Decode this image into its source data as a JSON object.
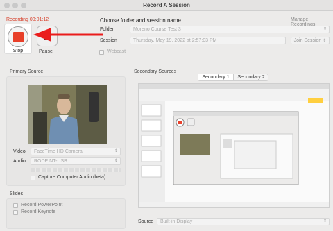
{
  "window": {
    "title": "Record A Session"
  },
  "recording": {
    "status": "Recording 00:01:12"
  },
  "controls": {
    "stop_label": "Stop",
    "pause_label": "Pause"
  },
  "header": {
    "choose_label": "Choose folder and session name",
    "manage_label": "Manage Recordings"
  },
  "folder": {
    "label": "Folder",
    "value": "Moreno Course Test 3"
  },
  "session": {
    "label": "Session",
    "value": "Thursday, May 19, 2022 at 2:57:03 PM",
    "join_label": "Join Session"
  },
  "webcast": {
    "label": "Webcast"
  },
  "primary": {
    "title": "Primary Source",
    "video_label": "Video",
    "video_value": "FaceTime HD Camera",
    "audio_label": "Audio",
    "audio_value": "RODE NT-USB",
    "capture_audio_label": "Capture Computer Audio (beta)"
  },
  "slides": {
    "title": "Slides",
    "record_powerpoint": "Record PowerPoint",
    "record_keynote": "Record Keynote"
  },
  "secondary": {
    "title": "Secondary Sources",
    "tabs": [
      "Secondary 1",
      "Secondary 2"
    ],
    "source_label": "Source",
    "source_value": "Built-in Display"
  }
}
